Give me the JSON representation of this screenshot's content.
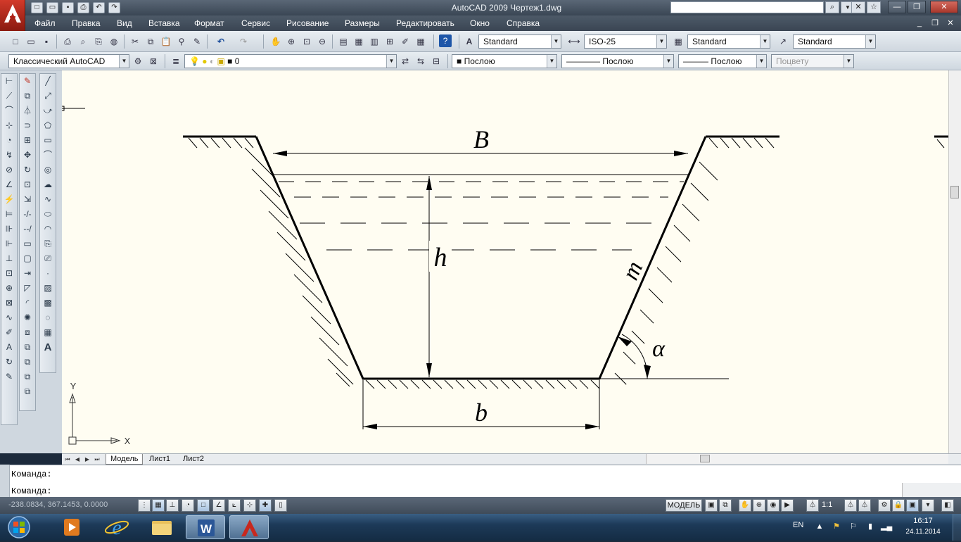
{
  "window": {
    "title": "AutoCAD 2009 Чертеж1.dwg"
  },
  "menu": [
    "Файл",
    "Правка",
    "Вид",
    "Вставка",
    "Формат",
    "Сервис",
    "Рисование",
    "Размеры",
    "Редактировать",
    "Окно",
    "Справка"
  ],
  "styles_toolbar": {
    "text_style": "Standard",
    "dim_style": "ISO-25",
    "table_style": "Standard",
    "multileader_style": "Standard"
  },
  "layers_toolbar": {
    "workspace": "Классический AutoCAD",
    "layer": "0",
    "color": "Послою",
    "linetype": "Послою",
    "lineweight": "Послою",
    "plot_style": "Поцвету"
  },
  "drawing": {
    "label_B": "B",
    "label_h": "h",
    "label_m": "m",
    "label_alpha": "α",
    "label_b": "b",
    "ucs_x": "X",
    "ucs_y": "Y"
  },
  "tabs": [
    "Модель",
    "Лист1",
    "Лист2"
  ],
  "command_line": {
    "line1": "Команда:",
    "line2": "Команда:"
  },
  "status": {
    "coords": "-238.0834, 367.1453, 0.0000",
    "model_button": "МОДЕЛЬ",
    "annotation_scale": "1:1"
  },
  "taskbar": {
    "lang": "EN",
    "time": "16:17",
    "date": "24.11.2014"
  },
  "colors": {
    "canvas_bg": "#fffdf2",
    "title_bar": "#4a5563",
    "autocad_red": "#c8281e"
  }
}
